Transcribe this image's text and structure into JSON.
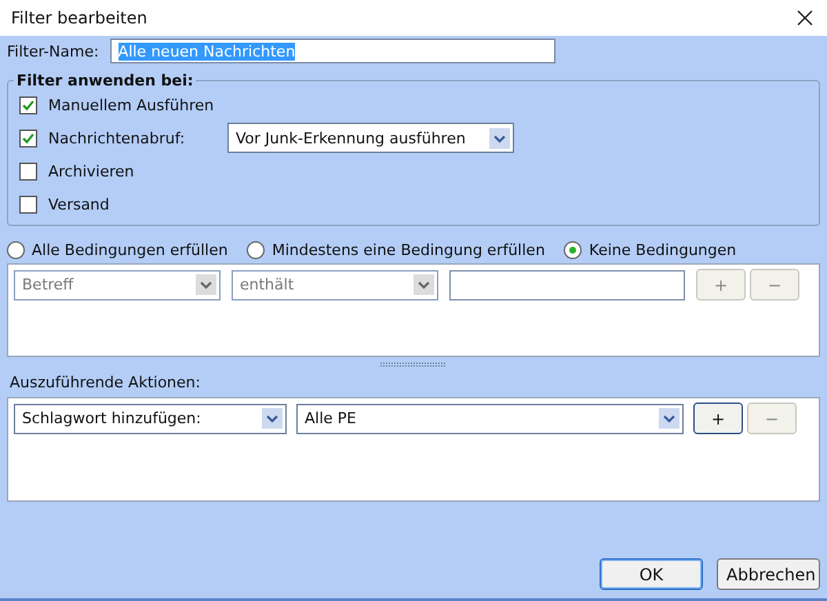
{
  "window": {
    "title": "Filter bearbeiten"
  },
  "filter_name": {
    "label": "Filter-Name:",
    "value": "Alle neuen Nachrichten",
    "text_selected": true
  },
  "apply_group": {
    "title": "Filter anwenden bei:",
    "options": [
      {
        "label": "Manuellem Ausführen",
        "checked": true
      },
      {
        "label": "Nachrichtenabruf:",
        "checked": true,
        "dropdown": "Vor Junk-Erkennung ausführen"
      },
      {
        "label": "Archivieren",
        "checked": false
      },
      {
        "label": "Versand",
        "checked": false
      }
    ]
  },
  "match_mode": [
    {
      "label": "Alle Bedingungen erfüllen",
      "selected": false
    },
    {
      "label": "Mindestens eine Bedingung erfüllen",
      "selected": false
    },
    {
      "label": "Keine Bedingungen",
      "selected": true
    }
  ],
  "conditions": [
    {
      "field": "Betreff",
      "operator": "enthält",
      "disabled": true,
      "add": "+",
      "add_disabled": true,
      "remove": "−",
      "remove_disabled": true
    }
  ],
  "actions": {
    "label": "Auszuführende Aktionen:",
    "rows": [
      {
        "action": "Schlagwort hinzufügen:",
        "target": "Alle PE",
        "add": "+",
        "add_disabled": false,
        "remove": "−",
        "remove_disabled": true
      }
    ]
  },
  "buttons": [
    {
      "label": "OK",
      "default": true
    },
    {
      "label": "Abbrechen",
      "default": false
    }
  ]
}
